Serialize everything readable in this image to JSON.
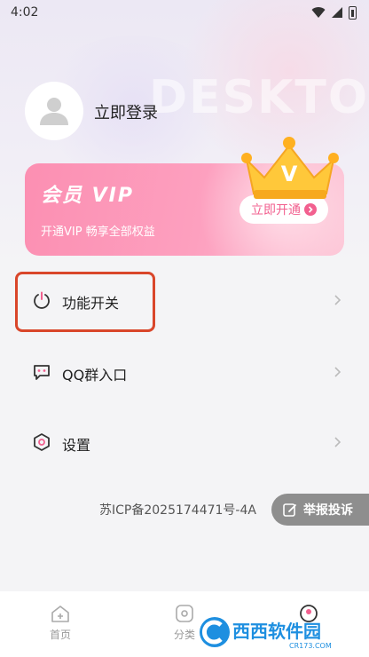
{
  "status_bar": {
    "time": "4:02"
  },
  "background": {
    "watermark": "DESKTO"
  },
  "profile": {
    "login_label": "立即登录"
  },
  "vip": {
    "title": "会员 VIP",
    "subtitle": "开通VIP   畅享全部权益",
    "button_label": "立即开通",
    "crown_letter": "V"
  },
  "menu": [
    {
      "label": "功能开关",
      "icon": "power-icon"
    },
    {
      "label": "QQ群入口",
      "icon": "chat-bubble-icon"
    },
    {
      "label": "设置",
      "icon": "settings-hexagon-icon"
    }
  ],
  "footer": {
    "icp": "苏ICP备2025174471号-4A",
    "report_label": "举报投诉"
  },
  "tabbar": {
    "items": [
      {
        "label": "首页",
        "icon": "home-icon"
      },
      {
        "label": "分类",
        "icon": "category-icon"
      },
      {
        "label": "",
        "icon": "profile-icon"
      }
    ]
  },
  "overlay_watermark": {
    "text": "西西软件园",
    "sub": "CR173.COM"
  },
  "colors": {
    "accent": "#f2608f",
    "highlight": "#d9462a",
    "report_bg": "#8e8e8e"
  }
}
